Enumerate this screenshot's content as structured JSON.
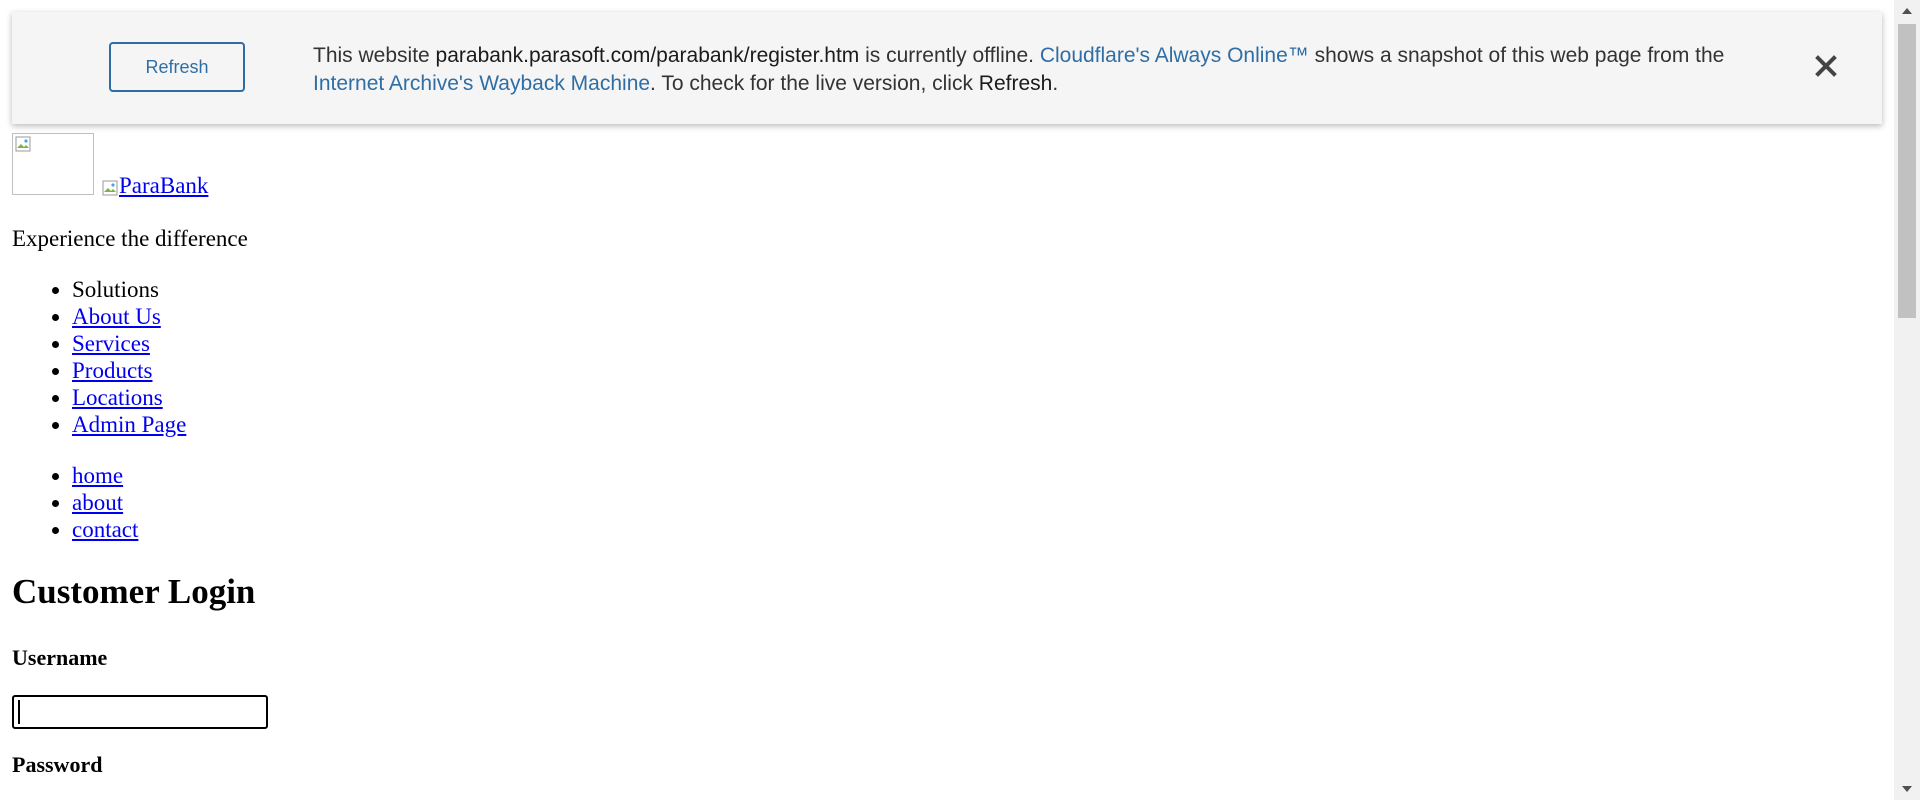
{
  "banner": {
    "refresh_label": "Refresh",
    "msg_prefix": "This website ",
    "site_url": "parabank.parasoft.com/parabank/register.htm",
    "msg_offline": " is currently offline. ",
    "always_online_link": "Cloudflare's Always Online™",
    "msg_snapshot": " shows a snapshot of this web page from the ",
    "wayback_link": "Internet Archive's Wayback Machine",
    "msg_check": ". To check for the live version, click ",
    "msg_refresh_word": "Refresh",
    "msg_end": ".",
    "close_icon": "close-icon",
    "accent_color": "#2f6ea4",
    "background_color": "#f5f5f5"
  },
  "header": {
    "logo_alt_icon": "broken-image-icon",
    "brand_link": "ParaBank",
    "tagline": "Experience the difference"
  },
  "solutions_menu": {
    "items": [
      {
        "label": "Solutions"
      },
      {
        "label": "About Us"
      },
      {
        "label": "Services"
      },
      {
        "label": "Products"
      },
      {
        "label": "Locations"
      },
      {
        "label": "Admin Page"
      }
    ]
  },
  "top_menu": {
    "items": [
      {
        "label": "home"
      },
      {
        "label": "about"
      },
      {
        "label": "contact"
      }
    ]
  },
  "login": {
    "title": "Customer Login",
    "username_label": "Username",
    "username_value": "",
    "password_label": "Password"
  },
  "scrollbar": {
    "up_icon": "scroll-up-arrow-icon",
    "down_icon": "scroll-down-arrow-icon"
  }
}
